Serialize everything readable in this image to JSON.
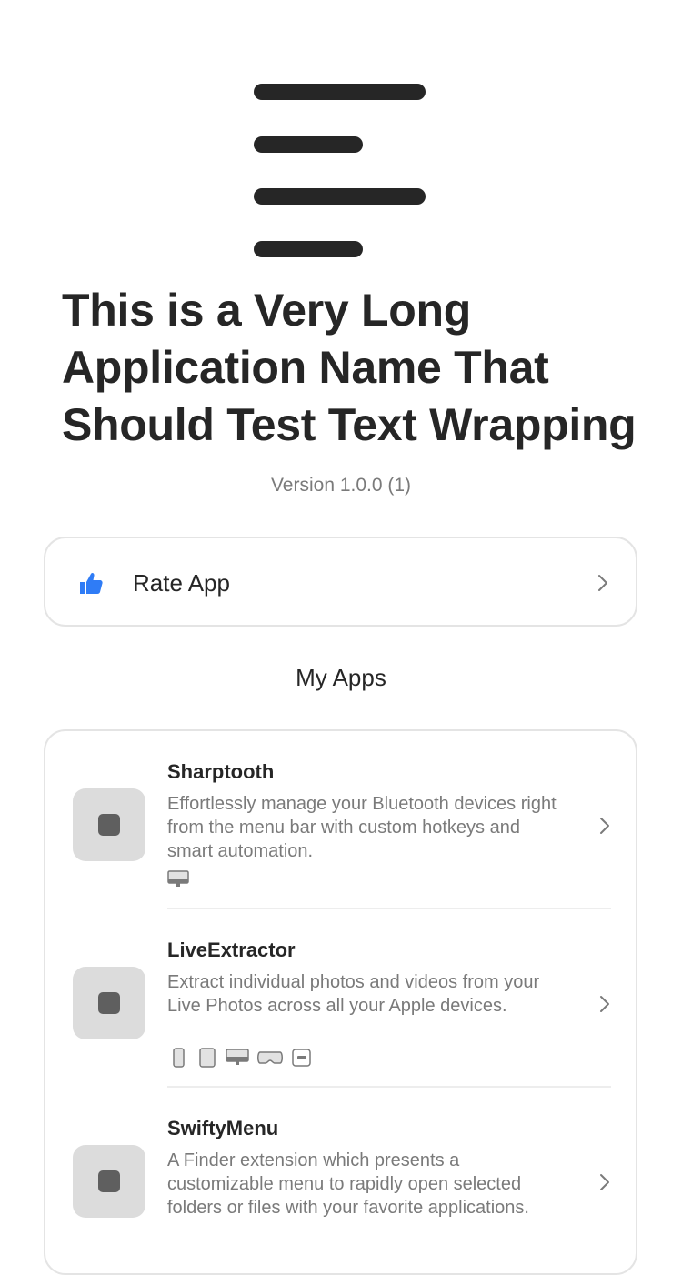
{
  "app": {
    "title": "This is a Very Long Application Name That Should Test Text Wrapping",
    "version": "Version 1.0.0 (1)",
    "icon": "app-logo-lines-icon"
  },
  "rate": {
    "label": "Rate App",
    "icon": "thumbs-up-icon",
    "accent": "#2f7cf6"
  },
  "my_apps": {
    "title": "My Apps",
    "items": [
      {
        "name": "Sharptooth",
        "description": "Effortlessly manage your Bluetooth devices right from the menu bar with custom hotkeys and smart automation.",
        "platforms": [
          "mac-icon"
        ]
      },
      {
        "name": "LiveExtractor",
        "description": "Extract individual photos and videos from your Live Photos across all your Apple devices.",
        "platforms": [
          "iphone-icon",
          "ipad-icon",
          "mac-icon",
          "vision-pro-icon",
          "apple-tv-icon"
        ]
      },
      {
        "name": "SwiftyMenu",
        "description": "A Finder extension which presents a customizable menu to rapidly open selected folders or files with your favorite applications.",
        "platforms": []
      }
    ]
  }
}
